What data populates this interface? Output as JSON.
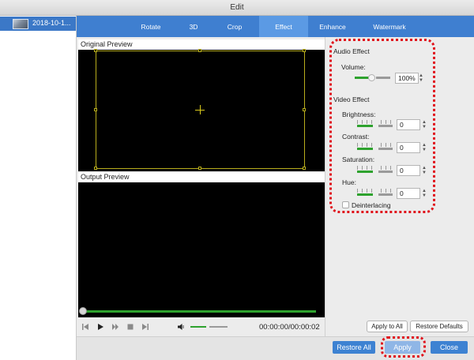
{
  "window": {
    "title": "Edit"
  },
  "sidebar": {
    "items": [
      {
        "label": "2018-10-1..."
      }
    ]
  },
  "tabs": [
    {
      "label": "Rotate",
      "active": false
    },
    {
      "label": "3D",
      "active": false
    },
    {
      "label": "Crop",
      "active": false
    },
    {
      "label": "Effect",
      "active": true
    },
    {
      "label": "Enhance",
      "active": false
    },
    {
      "label": "Watermark",
      "active": false
    }
  ],
  "preview": {
    "original_label": "Original Preview",
    "output_label": "Output Preview",
    "timecode": "00:00:00/00:00:02",
    "progress_fraction": 0.0
  },
  "audio": {
    "section_label": "Audio Effect",
    "volume_label": "Volume:",
    "volume_value": "100%"
  },
  "video": {
    "section_label": "Video Effect",
    "brightness_label": "Brightness:",
    "brightness_value": "0",
    "contrast_label": "Contrast:",
    "contrast_value": "0",
    "saturation_label": "Saturation:",
    "saturation_value": "0",
    "hue_label": "Hue:",
    "hue_value": "0",
    "deinterlacing_label": "Deinterlacing",
    "deinterlacing_checked": false
  },
  "buttons": {
    "apply_to_all": "Apply to All",
    "restore_defaults": "Restore Defaults",
    "restore_all": "Restore All",
    "apply": "Apply",
    "close": "Close"
  },
  "colors": {
    "tab_bar": "#3f7fd0",
    "active_tab": "#5b9ae4",
    "slider_green": "#2ea22e",
    "highlight_red": "#e0121b",
    "button_blue": "#3d82d2"
  }
}
